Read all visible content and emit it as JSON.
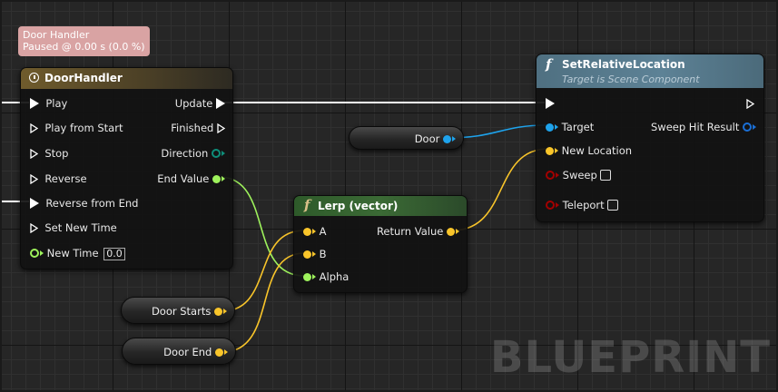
{
  "colors": {
    "exec": "#ffffff",
    "object": "#1ea3ec",
    "vector": "#f9c52a",
    "float": "#9ef25c",
    "bool": "#a30000",
    "function_header": "#5b7f92",
    "timeline_header": "#6f5b2c",
    "lerp_header": "#2e5a2a",
    "debug_box": "#d9a3a3"
  },
  "debug": {
    "title": "Door Handler",
    "status": "Paused @ 0.00 s (0.0 %)"
  },
  "timeline": {
    "title": "DoorHandler",
    "icon": "clock-icon",
    "inputs": [
      "Play",
      "Play from Start",
      "Stop",
      "Reverse",
      "Reverse from End",
      "Set New Time",
      "New Time"
    ],
    "outputs": [
      "Update",
      "Finished",
      "Direction",
      "End Value"
    ],
    "new_time_value": "0.0"
  },
  "set_location": {
    "title": "SetRelativeLocation",
    "subtitle": "Target is Scene Component",
    "icon": "function-icon",
    "inputs": [
      "Target",
      "New Location",
      "Sweep",
      "Teleport"
    ],
    "output": "Sweep Hit Result"
  },
  "lerp": {
    "title": "Lerp (vector)",
    "icon": "function-icon",
    "inputs": [
      "A",
      "B",
      "Alpha"
    ],
    "output": "Return Value"
  },
  "variables": {
    "door": "Door",
    "door_starts": "Door Starts",
    "door_end": "Door End"
  },
  "watermark": "BLUEPRINT"
}
